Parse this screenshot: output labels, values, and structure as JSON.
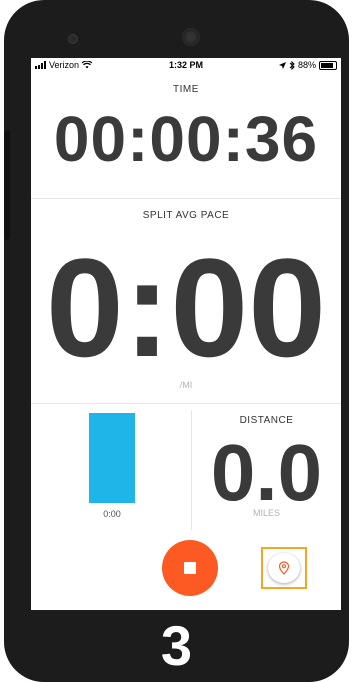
{
  "status_bar": {
    "carrier": "Verizon",
    "time": "1:32 PM",
    "battery": "88%"
  },
  "time": {
    "label": "TIME",
    "value": "00:00:36"
  },
  "pace": {
    "label": "SPLIT AVG PACE",
    "value": "0:00",
    "unit": "/MI"
  },
  "split": {
    "time": "0:00",
    "bar_color": "#1fb5e9"
  },
  "distance": {
    "label": "DISTANCE",
    "value": "0.0",
    "unit": "MILES"
  },
  "controls": {
    "stop_color": "#fc5a22",
    "location_highlight_color": "#f5a623"
  },
  "countdown": "3"
}
